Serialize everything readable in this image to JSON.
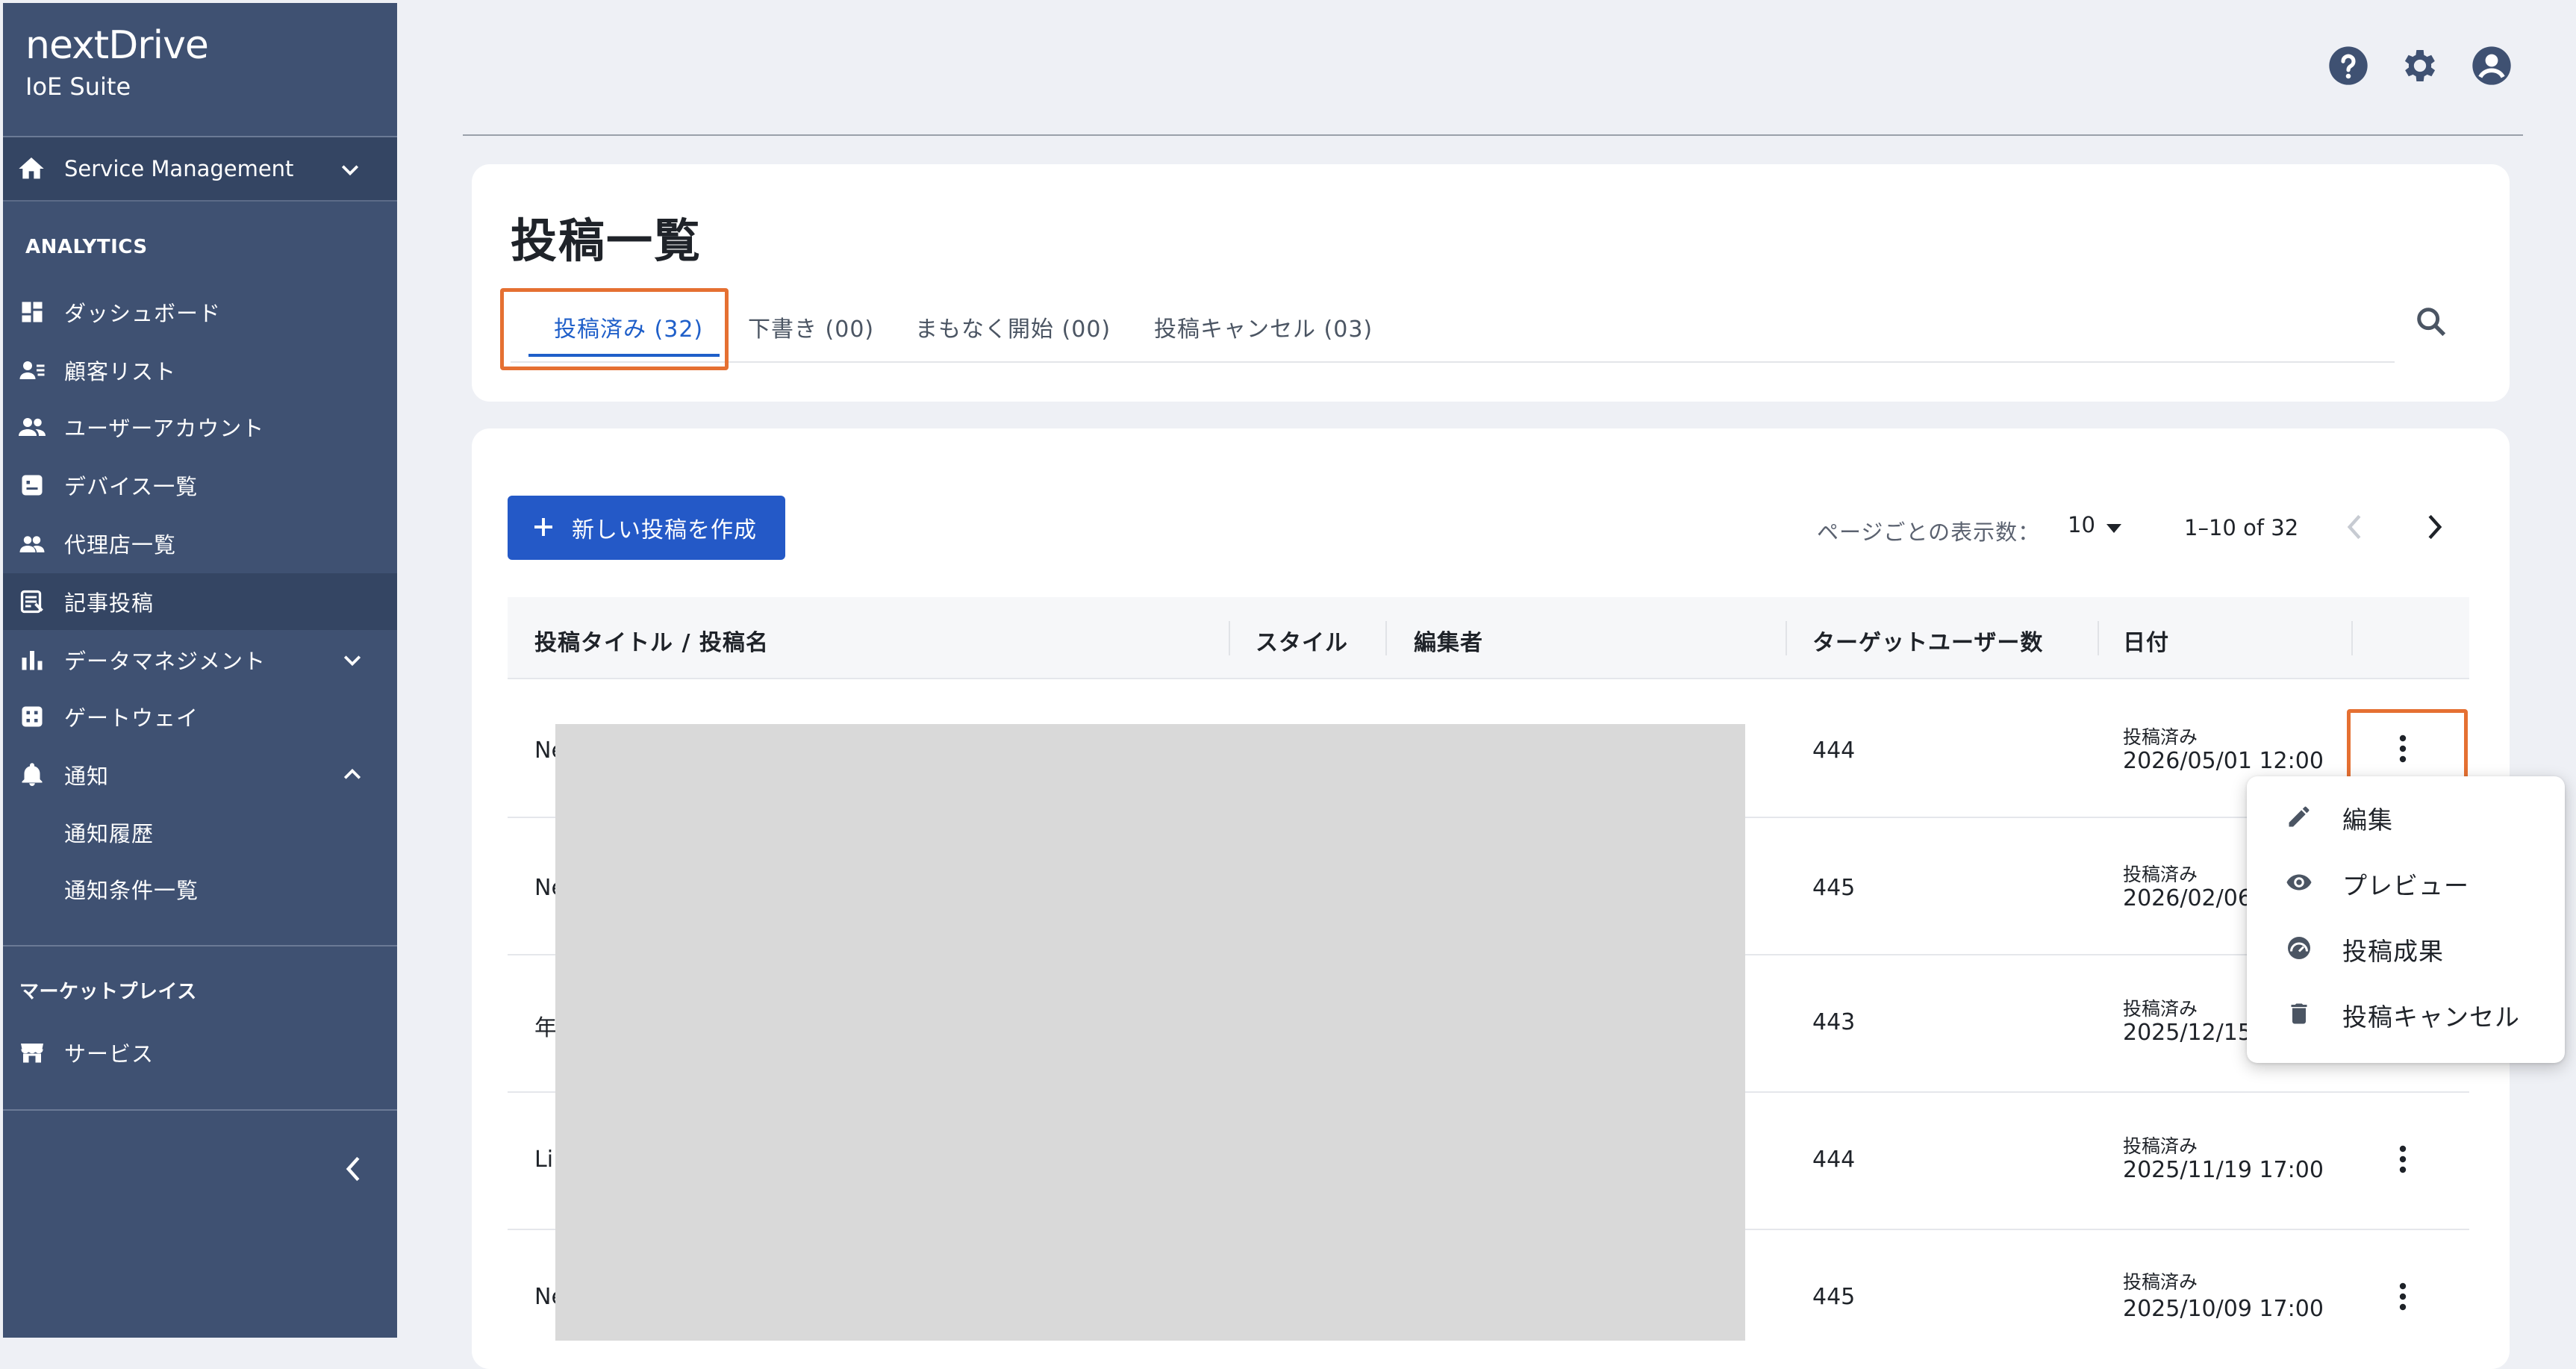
{
  "brand": {
    "logo": "nextDrive",
    "product": "IoE Suite"
  },
  "sidebar": {
    "service": "Service Management",
    "analytics_title": "ANALYTICS",
    "nav": [
      {
        "label": "ダッシュボード",
        "icon": "dashboard-icon"
      },
      {
        "label": "顧客リスト",
        "icon": "customer-list-icon"
      },
      {
        "label": "ユーザーアカウント",
        "icon": "users-icon"
      },
      {
        "label": "デバイス一覧",
        "icon": "device-icon"
      },
      {
        "label": "代理店一覧",
        "icon": "agency-icon"
      },
      {
        "label": "記事投稿",
        "icon": "article-icon"
      },
      {
        "label": "データマネジメント",
        "icon": "bar-chart-icon"
      },
      {
        "label": "ゲートウェイ",
        "icon": "gateway-icon"
      },
      {
        "label": "通知",
        "icon": "bell-icon"
      }
    ],
    "sub_nav": [
      "通知履歴",
      "通知条件一覧"
    ],
    "marketplace_title": "マーケットプレイス",
    "marketplace_item": "サービス"
  },
  "header": {
    "icons": [
      "help-icon",
      "gear-icon",
      "account-icon"
    ]
  },
  "page": {
    "title": "投稿一覧",
    "tabs": [
      "投稿済み (32)",
      "下書き (00)",
      "まもなく開始 (00)",
      "投稿キャンセル (03)"
    ],
    "active_tab": 0
  },
  "toolbar": {
    "create_label": "新しい投稿を作成"
  },
  "pagination": {
    "rows_label": "ページごとの表示数：",
    "rows_value": "10",
    "range": "1–10 of 32"
  },
  "table": {
    "headers": [
      "投稿タイトル / 投稿名",
      "スタイル",
      "編集者",
      "ターゲットユーザー数",
      "日付"
    ],
    "rows": [
      {
        "title": "Ne",
        "target": "444",
        "status": "投稿済み",
        "date": "2026/05/01 12:00"
      },
      {
        "title": "Ne",
        "target": "445",
        "status": "投稿済み",
        "date": "2026/02/06"
      },
      {
        "title": "年",
        "target": "443",
        "status": "投稿済み",
        "date": "2025/12/15"
      },
      {
        "title": "Li",
        "target": "444",
        "status": "投稿済み",
        "date": "2025/11/19 17:00"
      },
      {
        "title": "Ne",
        "target": "445",
        "status": "投稿済み",
        "date": "2025/10/09 17:00"
      }
    ]
  },
  "row_menu": {
    "items": [
      {
        "label": "編集",
        "icon": "pencil-icon"
      },
      {
        "label": "プレビュー",
        "icon": "eye-icon"
      },
      {
        "label": "投稿成果",
        "icon": "gauge-icon"
      },
      {
        "label": "投稿キャンセル",
        "icon": "trash-icon"
      }
    ]
  },
  "colors": {
    "sidebar": "#3f5172",
    "primary": "#2459c7",
    "highlight": "#e57032"
  }
}
